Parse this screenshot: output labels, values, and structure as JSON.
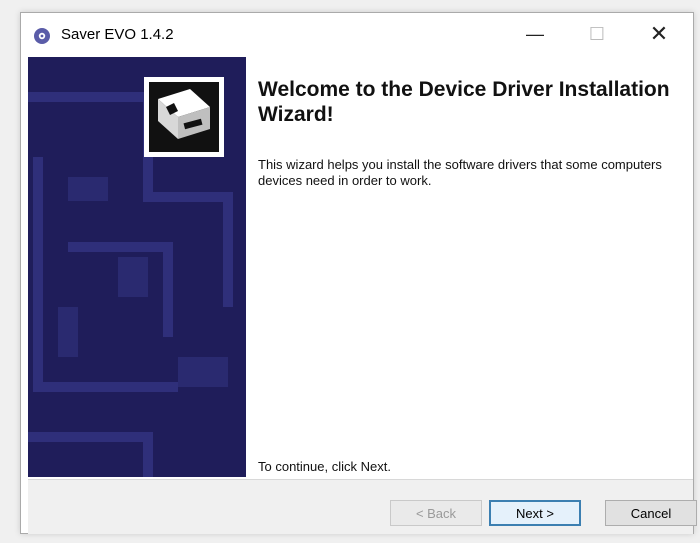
{
  "window": {
    "title": "Saver EVO 1.4.2",
    "controls": {
      "minimize": "—",
      "maximize": "☐",
      "close": "✕"
    }
  },
  "wizard": {
    "heading": "Welcome to the Device Driver Installation Wizard!",
    "description": "This wizard helps you install the software drivers that some computers devices need in order to work.",
    "continue_hint": "To continue, click Next."
  },
  "buttons": {
    "back": "< Back",
    "next": "Next >",
    "cancel": "Cancel"
  },
  "colors": {
    "side_panel": "#1f1d5a",
    "next_border": "#3c7fb1"
  },
  "icons": {
    "app": "gear-icon",
    "wizard": "driver-install-icon"
  }
}
